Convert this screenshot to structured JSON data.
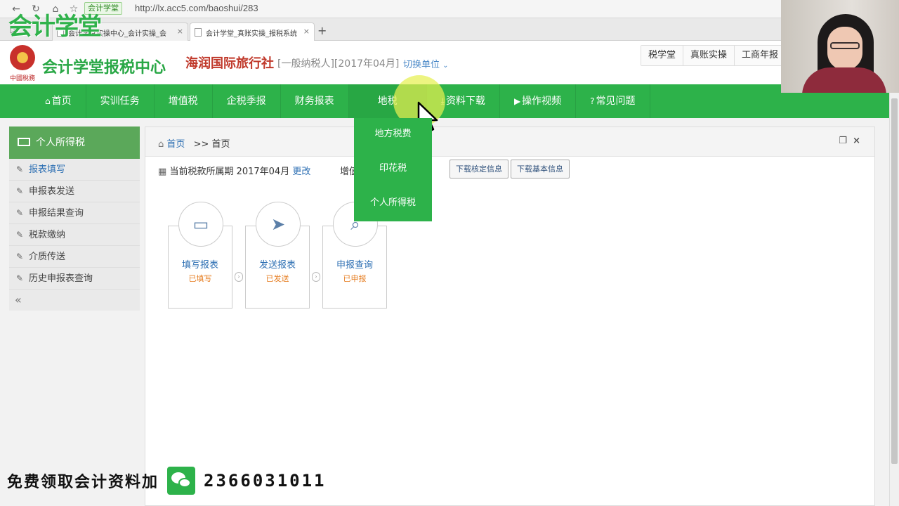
{
  "browser": {
    "site_chip": "会计学堂",
    "url": "http://lx.acc5.com/baoshui/283",
    "tabs": [
      {
        "label": "会计学堂实操中心_会计实操_会"
      },
      {
        "label": "会计学堂_真账实操_报税系统"
      }
    ],
    "new_tab": "+",
    "watermark_logo": "会计学堂"
  },
  "header": {
    "emblem_text": "中國稅務",
    "site_title": "会计学堂报税中心",
    "company_name": "海润国际旅行社",
    "company_meta": "[一般纳税人][2017年04月]",
    "switch_unit": "切换单位",
    "top_links": [
      "税学堂",
      "真账实操",
      "工商年报"
    ]
  },
  "nav": {
    "items": [
      {
        "label": "首页",
        "icon": "home-icon"
      },
      {
        "label": "实训任务"
      },
      {
        "label": "增值税"
      },
      {
        "label": "企税季报"
      },
      {
        "label": "财务报表"
      },
      {
        "label": "地税"
      },
      {
        "label": "资料下载",
        "icon": "download-icon"
      },
      {
        "label": "操作视频",
        "icon": "play-icon"
      },
      {
        "label": "常见问题",
        "icon": "question-icon"
      }
    ],
    "dropdown": [
      "地方税费",
      "印花税",
      "个人所得税"
    ]
  },
  "sidebar": {
    "title": "个人所得税",
    "items": [
      {
        "label": "报表填写"
      },
      {
        "label": "申报表发送"
      },
      {
        "label": "申报结果查询"
      },
      {
        "label": "税款缴纳"
      },
      {
        "label": "介质传送"
      },
      {
        "label": "历史申报表查询"
      }
    ],
    "collapse": "«"
  },
  "panel": {
    "breadcrumb_home": "首页",
    "breadcrumb_current": ">> 首页",
    "period_label": "当前税款所属期 2017年04月",
    "period_change": "更改",
    "partial_label": "增值",
    "buttons": [
      "下载核定信息",
      "下载基本信息"
    ],
    "cards": [
      {
        "title": "填写报表",
        "status": "已填写",
        "icon": "monitor-icon"
      },
      {
        "title": "发送报表",
        "status": "已发送",
        "icon": "paper-plane-icon"
      },
      {
        "title": "申报查询",
        "status": "已申报",
        "icon": "search-icon"
      }
    ]
  },
  "promo": {
    "text": "免费领取会计资料加",
    "number": "2366031011"
  }
}
